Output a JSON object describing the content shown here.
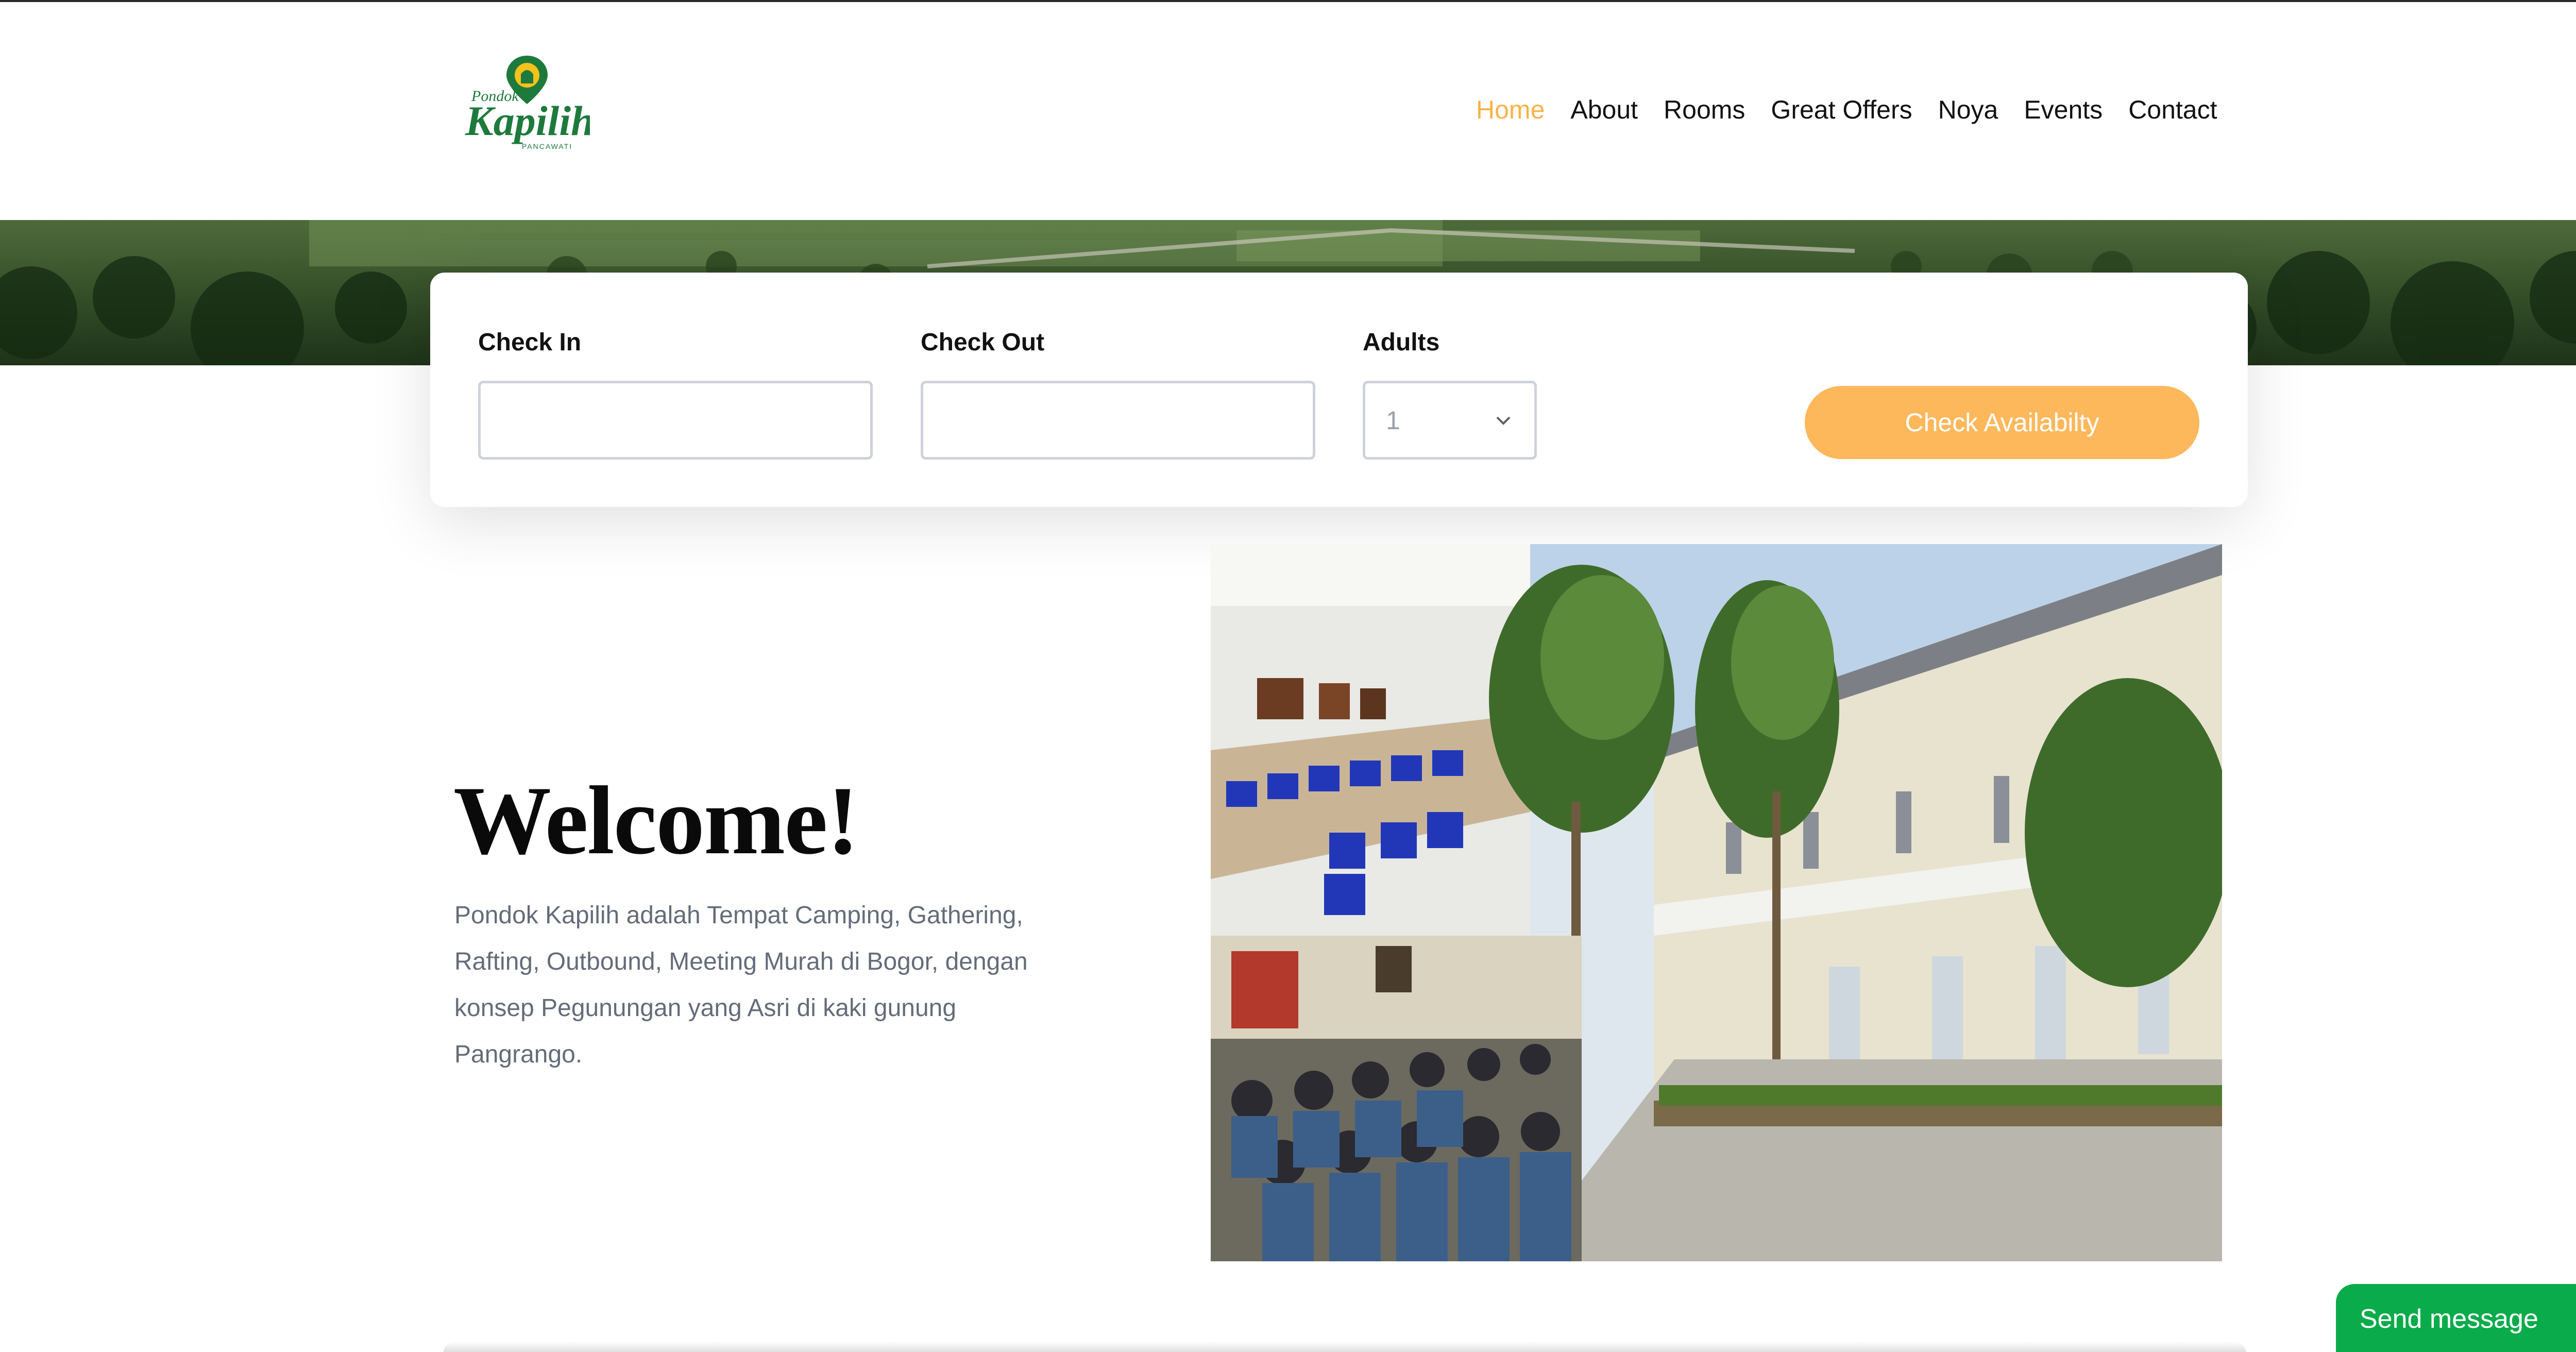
{
  "brand": {
    "logo_line1": "Pondok",
    "logo_line2": "Kapilih",
    "logo_line3": "PANCAWATI",
    "primary_color": "#1e7a3c",
    "accent_color": "#f7b448"
  },
  "nav": {
    "items": [
      {
        "label": "Home",
        "active": true
      },
      {
        "label": "About",
        "active": false
      },
      {
        "label": "Rooms",
        "active": false
      },
      {
        "label": "Great Offers",
        "active": false
      },
      {
        "label": "Noya",
        "active": false
      },
      {
        "label": "Events",
        "active": false
      },
      {
        "label": "Contact",
        "active": false
      }
    ]
  },
  "booking": {
    "check_in_label": "Check In",
    "check_in_value": "",
    "check_out_label": "Check Out",
    "check_out_value": "",
    "adults_label": "Adults",
    "adults_value": "1",
    "button_label": "Check Availabilty",
    "button_color": "#fcb85b"
  },
  "welcome": {
    "title": "Welcome!",
    "text": "Pondok Kapilih adalah Tempat Camping, Gathering, Rafting, Outbound, Meeting Murah di Bogor, dengan konsep Pegunungan yang Asri di kaki gunung Pangrango."
  },
  "chat": {
    "label": "Send message",
    "color": "#0aab4a"
  }
}
